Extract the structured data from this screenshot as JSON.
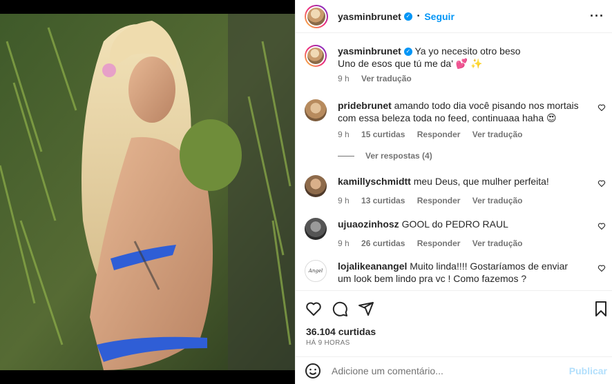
{
  "post": {
    "author": "yasminbrunet",
    "follow_label": "Seguir",
    "dot": "•",
    "more_icon": "more-options-icon",
    "caption_line1": "Ya yo necesito otro beso",
    "caption_line2": "Uno de esos que tú me da' 💕 ✨",
    "caption_time": "9 h",
    "caption_translate": "Ver tradução"
  },
  "comments": [
    {
      "user": "pridebrunet",
      "text": "amando todo dia você pisando nos mortais com essa beleza toda no feed, continuaaa haha 😍",
      "time": "9 h",
      "likes": "15 curtidas",
      "reply": "Responder",
      "translate": "Ver tradução",
      "replies": "Ver respostas (4)"
    },
    {
      "user": "kamillyschmidtt",
      "text": "meu Deus, que mulher perfeita!",
      "time": "9 h",
      "likes": "13 curtidas",
      "reply": "Responder",
      "translate": "Ver tradução"
    },
    {
      "user": "ujuaozinhosz",
      "text": "GOOL do PEDRO RAUL",
      "time": "9 h",
      "likes": "26 curtidas",
      "reply": "Responder",
      "translate": "Ver tradução"
    },
    {
      "user": "lojalikeanangel",
      "text": "Muito linda!!!! Gostaríamos de enviar um look bem lindo pra vc ! Como fazemos ?",
      "avatar_text": "Angel"
    }
  ],
  "footer": {
    "likes": "36.104 curtidas",
    "time": "HÁ 9 HORAS",
    "comment_placeholder": "Adicione um comentário...",
    "publish": "Publicar"
  },
  "colors": {
    "accent": "#0095f6",
    "publish_disabled": "#b2dffc",
    "secondary_text": "#737373"
  }
}
